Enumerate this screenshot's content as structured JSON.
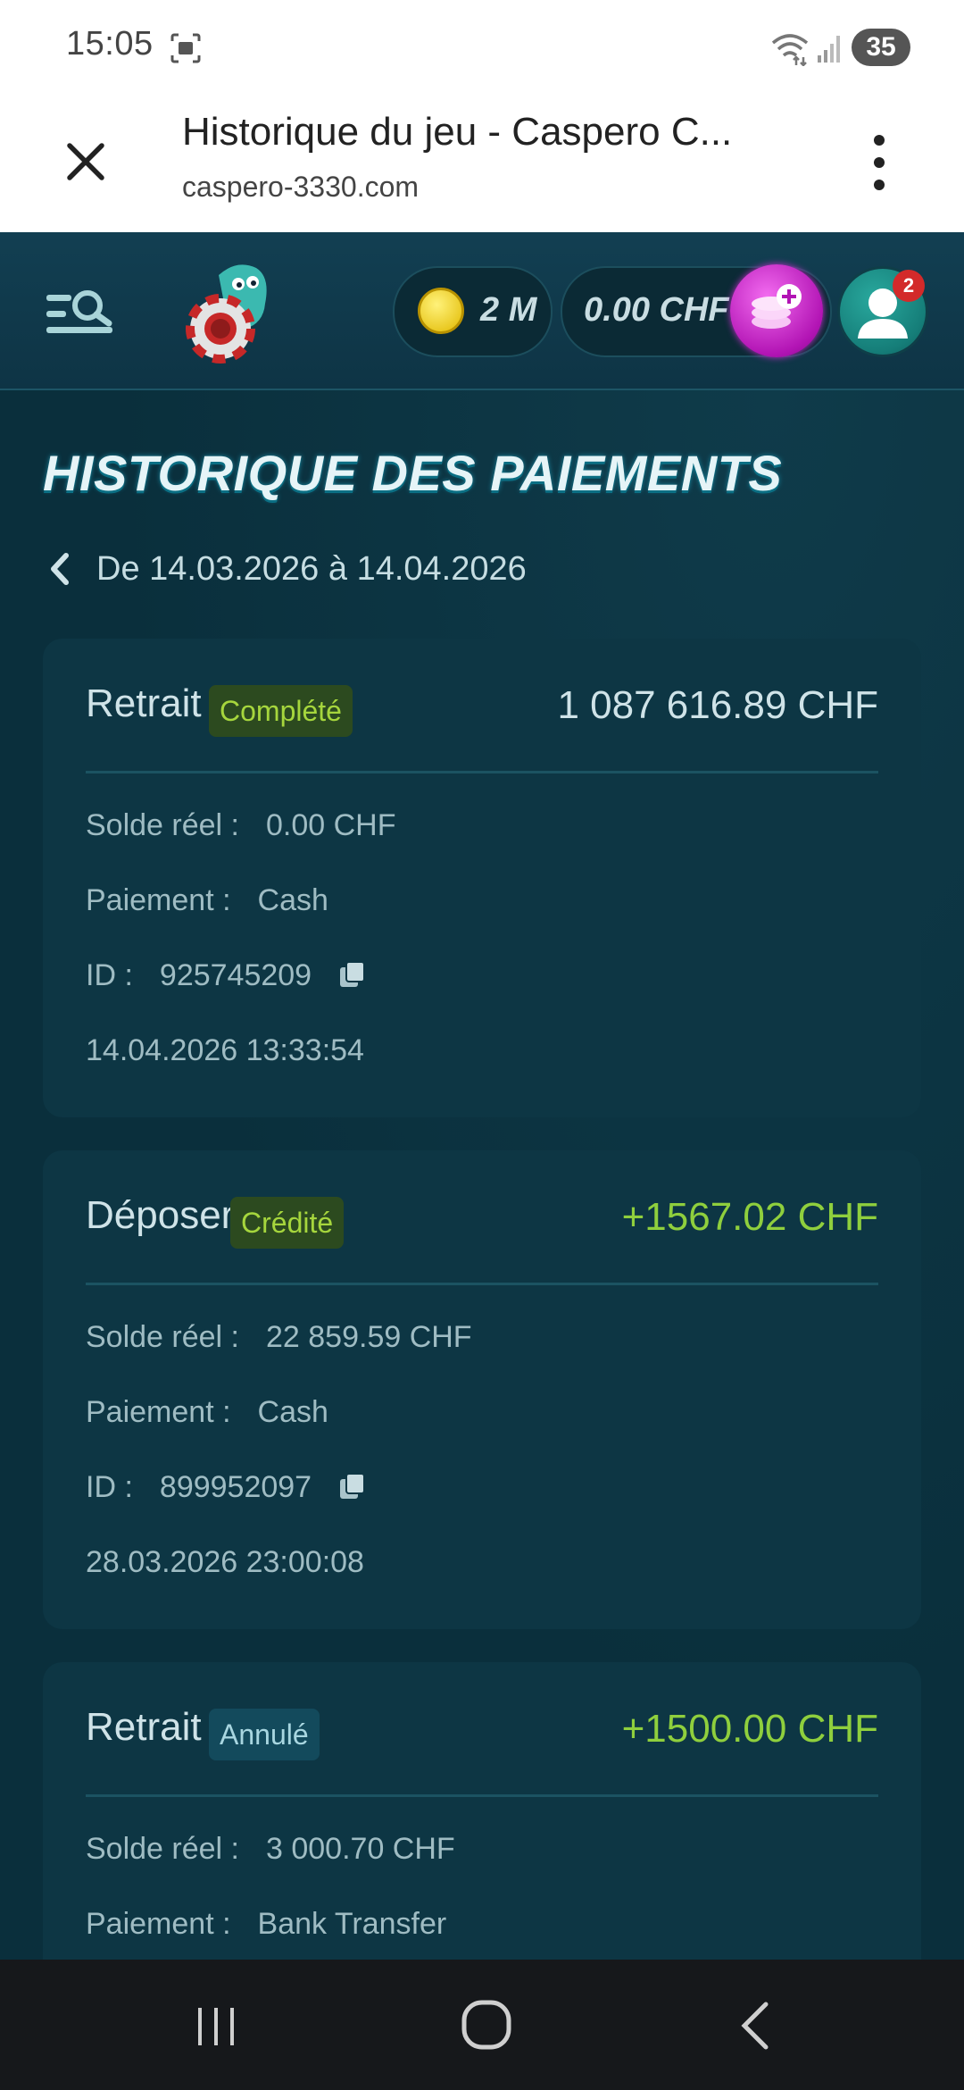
{
  "status_bar": {
    "time": "15:05",
    "battery": "35"
  },
  "browser": {
    "title": "Historique du jeu - Caspero C...",
    "url": "caspero-3330.com"
  },
  "header": {
    "coins": "2 M",
    "balance": "0.00 CHF",
    "notification_count": "2"
  },
  "page": {
    "title": "HISTORIQUE DES PAIEMENTS",
    "date_range": "De 14.03.2026 à 14.04.2026"
  },
  "transactions": [
    {
      "type": "Retrait",
      "status": "Complété",
      "amount": "1 087 616.89 CHF",
      "balance_label": "Solde réel :",
      "balance": "0.00 CHF",
      "payment_label": "Paiement :",
      "payment": "Cash",
      "id_label": "ID :",
      "id": "925745209",
      "datetime": "14.04.2026 13:33:54"
    },
    {
      "type": "Déposer",
      "status": "Crédité",
      "amount": "+1567.02 CHF",
      "balance_label": "Solde réel :",
      "balance": "22 859.59 CHF",
      "payment_label": "Paiement :",
      "payment": "Cash",
      "id_label": "ID :",
      "id": "899952097",
      "datetime": "28.03.2026 23:00:08"
    },
    {
      "type": "Retrait",
      "status": "Annulé",
      "amount": "+1500.00 CHF",
      "balance_label": "Solde réel :",
      "balance": "3 000.70 CHF",
      "payment_label": "Paiement :",
      "payment": "Bank Transfer"
    }
  ],
  "colors": {
    "background": "#0a2f3c",
    "card": "#0d3644",
    "positive_amount": "#8fcf3d",
    "status_green_text": "#a6d63d",
    "deposit_button": "#c52ecb",
    "badge_red": "#d32a2a"
  },
  "icons": [
    "screenshot-icon",
    "wifi-icon",
    "signal-icon",
    "close-icon",
    "more-vert-icon",
    "menu-search-icon",
    "casino-logo",
    "coin-icon",
    "deposit-icon",
    "user-icon",
    "chevron-left-icon",
    "copy-icon",
    "nav-recents-icon",
    "nav-home-icon",
    "nav-back-icon"
  ]
}
